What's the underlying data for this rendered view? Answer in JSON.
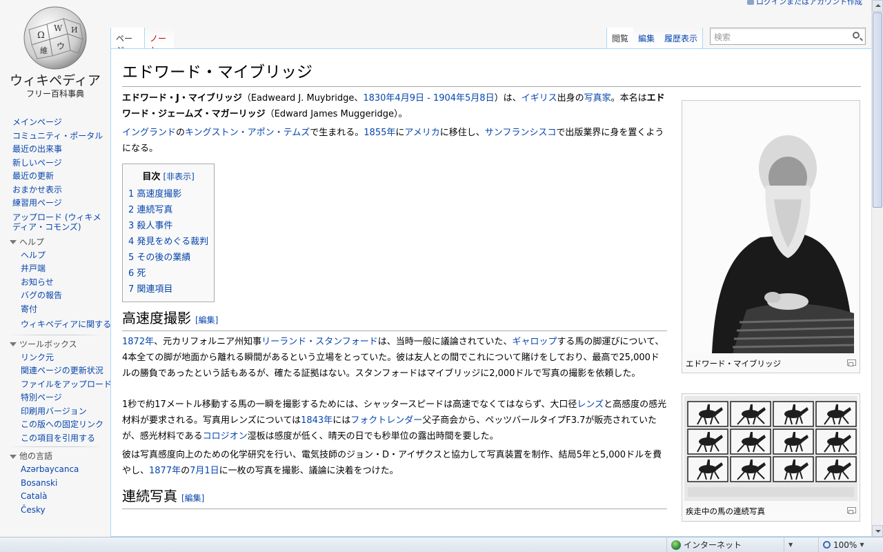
{
  "personal": {
    "login_label": "ログインまたはアカウント作成"
  },
  "logo": {
    "wordmark": "ウィキペディア",
    "tagline": "フリー百科事典"
  },
  "tabs": {
    "page": "ページ",
    "talk": "ノート",
    "read": "閲覧",
    "edit": "編集",
    "history": "履歴表示"
  },
  "search": {
    "placeholder": "検索"
  },
  "sidebar": {
    "main": [
      "メインページ",
      "コミュニティ・ポータル",
      "最近の出来事",
      "新しいページ",
      "最近の更新",
      "おまかせ表示",
      "練習用ページ",
      "アップロード (ウィキメディア・コモンズ)"
    ],
    "help": {
      "heading": "ヘルプ",
      "items": [
        "ヘルプ",
        "井戸端",
        "お知らせ",
        "バグの報告",
        "寄付",
        "ウィキペディアに関するお問い合わせ"
      ]
    },
    "toolbox": {
      "heading": "ツールボックス",
      "items": [
        "リンク元",
        "関連ページの更新状況",
        "ファイルをアップロード",
        "特別ページ",
        "印刷用バージョン",
        "この版への固定リンク",
        "この項目を引用する"
      ]
    },
    "languages": {
      "heading": "他の言語",
      "items": [
        "Azərbaycanca",
        "Bosanski",
        "Català",
        "Česky"
      ]
    }
  },
  "article": {
    "title": "エドワード・マイブリッジ",
    "intro1": {
      "name": "エドワード・J・マイブリッジ",
      "paren_open": "（Eadweard J. Muybridge、",
      "birth": "1830年4月9日",
      "dash": " - ",
      "death": "1904年5月8日",
      "paren_close": "）は、",
      "country": "イギリス",
      "from": "出身の",
      "job": "写真家",
      "realname_lead": "。本名は",
      "realname": "エドワード・ジェームズ・マガーリッジ",
      "realname_en": "（Edward James Muggeridge）。"
    },
    "intro2": {
      "place1": "イングランド",
      "no": "の",
      "place2": "キングストン・アポン・テムズ",
      "born": "で生まれる。",
      "year": "1855年",
      "ni": "に",
      "place3": "アメリカ",
      "moved": "に移住し、",
      "place4": "サンフランシスコ",
      "rest": "で出版業界に身を置くようになる。"
    },
    "toc": {
      "title": "目次",
      "hide": "[非表示]",
      "items": [
        "1 高速度撮影",
        "2 連続写真",
        "3 殺人事件",
        "4 発見をめぐる裁判",
        "5 その後の業績",
        "6 死",
        "7 関連項目"
      ]
    },
    "section1": {
      "heading": "高速度撮影",
      "edit": "[編集]",
      "p1": {
        "year": "1872年",
        "a": "、元カリフォルニア州知事",
        "person": "リーランド・スタンフォード",
        "b": "は、当時一般に議論されていた、",
        "gallop": "ギャロップ",
        "c": "する馬の脚運びについて、4本全ての脚が地面から離れる瞬間があるという立場をとっていた。彼は友人との間でこれについて賭けをしており、最高で25,000ドルの勝負であったという話もあるが、確たる証拠はない。スタンフォードはマイブリッジに2,000ドルで写真の撮影を依頼した。"
      },
      "p2": {
        "a": "1秒で約17メートル移動する馬の一瞬を撮影するためには、シャッタースピードは高速でなくてはならず、大口径",
        "lens": "レンズ",
        "b": "と高感度の感光材料が要求される。写真用レンズについては",
        "year": "1843年",
        "c": "には",
        "voigt": "フォクトレンダー",
        "d": "父子商会から、ペッツバールタイプF3.7が販売されていたが、感光材料である",
        "collodion": "コロジオン",
        "e": "湿板は感度が低く、晴天の日でも秒単位の露出時間を要した。"
      },
      "p3": {
        "a": "彼は写真感度向上のための化学研究を行い、電気技師のジョン・D・アイザクスと協力して写真装置を制作、結局5年と5,000ドルを費やし、",
        "year": "1877年",
        "b": "の",
        "date": "7月1日",
        "c": "に一枚の写真を撮影、議論に決着をつけた。"
      }
    },
    "section2": {
      "heading": "連続写真",
      "edit": "[編集]"
    },
    "thumb1": {
      "caption": "エドワード・マイブリッジ"
    },
    "thumb2": {
      "caption": "疾走中の馬の連続写真"
    }
  },
  "statusbar": {
    "zone": "インターネット",
    "zoom": "100%"
  }
}
